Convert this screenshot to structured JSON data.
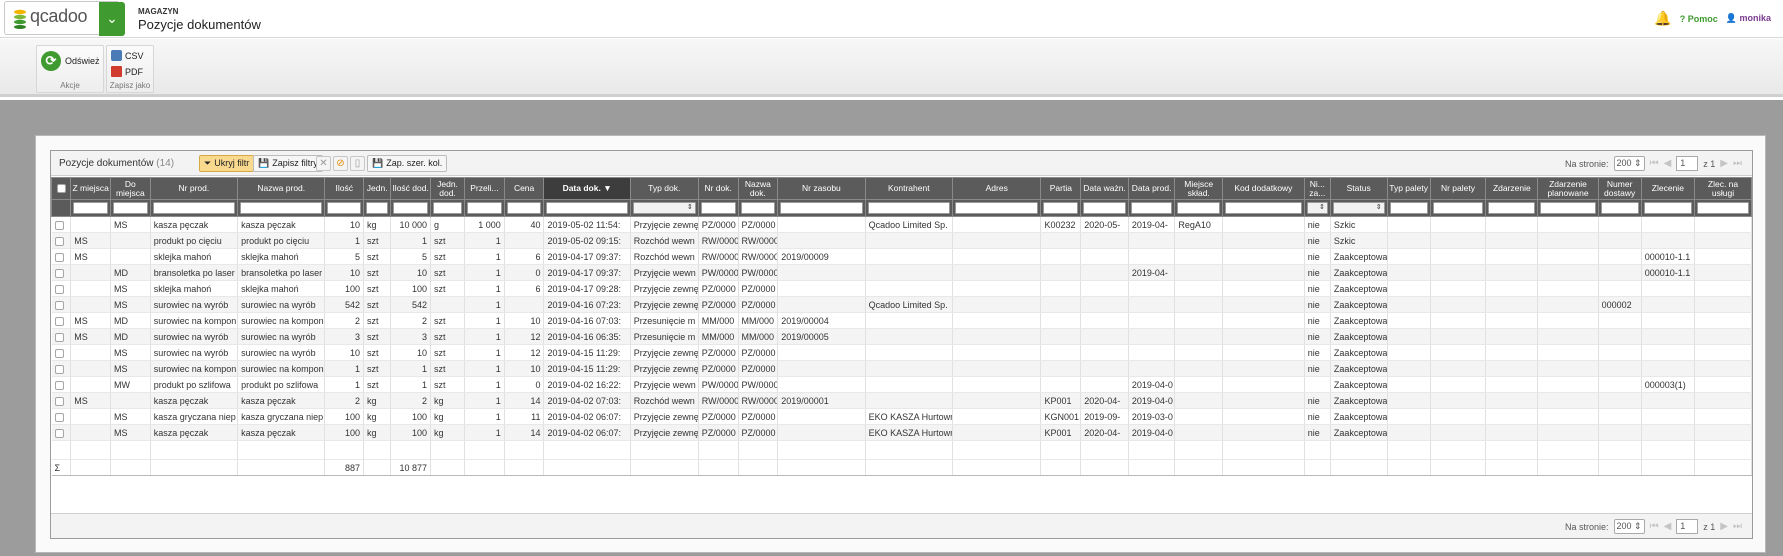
{
  "header": {
    "logo_text": "qcadoo",
    "section": "MAGAZYN",
    "title": "Pozycje dokumentów",
    "help": "Pomoc",
    "user": "monika"
  },
  "ribbon": {
    "refresh_label": "Odśwież",
    "actions_group": "Akcje",
    "csv_label": "CSV",
    "pdf_label": "PDF",
    "save_group": "Zapisz jako"
  },
  "grid": {
    "title": "Pozycje dokumentów",
    "count": "(14)",
    "hide_filter": "Ukryj filtr",
    "save_filters": "Zapisz filtry",
    "save_widths": "Zap. szer. kol.",
    "per_page_label": "Na stronie:",
    "per_page": "200",
    "page": "1",
    "of_pages": "z 1",
    "columns": [
      "",
      "Z miejsca",
      "Do miejsca",
      "Nr prod.",
      "Nazwa prod.",
      "Ilość",
      "Jedn.",
      "Ilość dod.",
      "Jedn. dod.",
      "Przeli...",
      "Cena",
      "Data dok.",
      "Typ dok.",
      "Nr dok.",
      "Nazwa dok.",
      "Nr zasobu",
      "Kontrahent",
      "Adres",
      "Partia",
      "Data ważn.",
      "Data prod.",
      "Miejsce skład.",
      "Kod dodatkowy",
      "Ni... za...",
      "Status",
      "Typ palety",
      "Nr palety",
      "Zdarzenie",
      "Zdarzenie planowane",
      "Numer dostawy",
      "Zlecenie",
      "Zlec. na usługi"
    ],
    "rows": [
      [
        "",
        "",
        "MS",
        "kasza pęczak",
        "kasza pęczak",
        "10",
        "kg",
        "10 000",
        "g",
        "1 000",
        "40",
        "2019-05-02 11:54:",
        "Przyjęcie zewnęt",
        "PZ/0000",
        "PZ/0000",
        "",
        "Qcadoo Limited Sp.",
        "",
        "K00232",
        "2020-05-",
        "2019-04-",
        "RegA10",
        "",
        "nie",
        "Szkic",
        "",
        "",
        "",
        "",
        "",
        "",
        ""
      ],
      [
        "",
        "MS",
        "",
        "produkt po cięciu",
        "produkt po cięciu",
        "1",
        "szt",
        "1",
        "szt",
        "1",
        "",
        "2019-05-02 09:15:",
        "Rozchód wewn",
        "RW/0000",
        "RW/0000",
        "",
        "",
        "",
        "",
        "",
        "",
        "",
        "",
        "nie",
        "Szkic",
        "",
        "",
        "",
        "",
        "",
        "",
        ""
      ],
      [
        "",
        "MS",
        "",
        "sklejka mahoń",
        "sklejka mahoń",
        "5",
        "szt",
        "5",
        "szt",
        "1",
        "6",
        "2019-04-17 09:37:",
        "Rozchód wewn",
        "RW/0000",
        "RW/0000",
        "2019/00009",
        "",
        "",
        "",
        "",
        "",
        "",
        "",
        "nie",
        "Zaakceptowa",
        "",
        "",
        "",
        "",
        "",
        "000010-1.1",
        ""
      ],
      [
        "",
        "",
        "MD",
        "bransoletka po laser",
        "bransoletka po laser",
        "10",
        "szt",
        "10",
        "szt",
        "1",
        "0",
        "2019-04-17 09:37:",
        "Przyjęcie wewn",
        "PW/0000",
        "PW/0000",
        "",
        "",
        "",
        "",
        "",
        "2019-04-",
        "",
        "",
        "nie",
        "Zaakceptowa",
        "",
        "",
        "",
        "",
        "",
        "000010-1.1",
        ""
      ],
      [
        "",
        "",
        "MS",
        "sklejka mahoń",
        "sklejka mahoń",
        "100",
        "szt",
        "100",
        "szt",
        "1",
        "6",
        "2019-04-17 09:28:",
        "Przyjęcie zewnęt",
        "PZ/0000",
        "PZ/0000",
        "",
        "",
        "",
        "",
        "",
        "",
        "",
        "",
        "nie",
        "Zaakceptowa",
        "",
        "",
        "",
        "",
        "",
        "",
        ""
      ],
      [
        "",
        "",
        "MS",
        "surowiec na wyrób",
        "surowiec na wyrób",
        "542",
        "szt",
        "542",
        "",
        "1",
        "",
        "2019-04-16 07:23:",
        "Przyjęcie zewnęt",
        "PZ/0000",
        "PZ/0000",
        "",
        "Qcadoo Limited Sp.",
        "",
        "",
        "",
        "",
        "",
        "",
        "nie",
        "Zaakceptowa",
        "",
        "",
        "",
        "",
        "000002",
        "",
        ""
      ],
      [
        "",
        "MS",
        "MD",
        "surowiec na kompon",
        "surowiec na kompon",
        "2",
        "szt",
        "2",
        "szt",
        "1",
        "10",
        "2019-04-16 07:03:",
        "Przesunięcie m",
        "MM/000",
        "MM/000",
        "2019/00004",
        "",
        "",
        "",
        "",
        "",
        "",
        "",
        "nie",
        "Zaakceptowa",
        "",
        "",
        "",
        "",
        "",
        "",
        ""
      ],
      [
        "",
        "MS",
        "MD",
        "surowiec na wyrób",
        "surowiec na wyrób",
        "3",
        "szt",
        "3",
        "szt",
        "1",
        "12",
        "2019-04-16 06:35:",
        "Przesunięcie m",
        "MM/000",
        "MM/000",
        "2019/00005",
        "",
        "",
        "",
        "",
        "",
        "",
        "",
        "nie",
        "Zaakceptowa",
        "",
        "",
        "",
        "",
        "",
        "",
        ""
      ],
      [
        "",
        "",
        "MS",
        "surowiec na wyrób",
        "surowiec na wyrób",
        "10",
        "szt",
        "10",
        "szt",
        "1",
        "12",
        "2019-04-15 11:29:",
        "Przyjęcie zewnęt",
        "PZ/0000",
        "PZ/0000",
        "",
        "",
        "",
        "",
        "",
        "",
        "",
        "",
        "nie",
        "Zaakceptowa",
        "",
        "",
        "",
        "",
        "",
        "",
        ""
      ],
      [
        "",
        "",
        "MS",
        "surowiec na kompon",
        "surowiec na kompon",
        "1",
        "szt",
        "1",
        "szt",
        "1",
        "10",
        "2019-04-15 11:29:",
        "Przyjęcie zewnęt",
        "PZ/0000",
        "PZ/0000",
        "",
        "",
        "",
        "",
        "",
        "",
        "",
        "",
        "nie",
        "Zaakceptowa",
        "",
        "",
        "",
        "",
        "",
        "",
        ""
      ],
      [
        "",
        "",
        "MW",
        "produkt po szlifowa",
        "produkt po szlifowa",
        "1",
        "szt",
        "1",
        "szt",
        "1",
        "0",
        "2019-04-02 16:22:",
        "Przyjęcie wewn",
        "PW/0000",
        "PW/0000",
        "",
        "",
        "",
        "",
        "",
        "2019-04-0",
        "",
        "",
        "",
        "Zaakceptowa",
        "",
        "",
        "",
        "",
        "",
        "000003(1)",
        ""
      ],
      [
        "",
        "MS",
        "",
        "kasza pęczak",
        "kasza pęczak",
        "2",
        "kg",
        "2",
        "kg",
        "1",
        "14",
        "2019-04-02 07:03:",
        "Rozchód wewn",
        "RW/0000",
        "RW/0000",
        "2019/00001",
        "",
        "",
        "KP001",
        "2020-04-",
        "2019-04-0",
        "",
        "",
        "nie",
        "Zaakceptowa",
        "",
        "",
        "",
        "",
        "",
        "",
        ""
      ],
      [
        "",
        "",
        "MS",
        "kasza gryczana niep",
        "kasza gryczana niep",
        "100",
        "kg",
        "100",
        "kg",
        "1",
        "11",
        "2019-04-02 06:07:",
        "Przyjęcie zewnęt",
        "PZ/0000",
        "PZ/0000",
        "",
        "EKO KASZA Hurtowr",
        "",
        "KGN001",
        "2019-09-",
        "2019-03-0",
        "",
        "",
        "nie",
        "Zaakceptowa",
        "",
        "",
        "",
        "",
        "",
        "",
        ""
      ],
      [
        "",
        "",
        "MS",
        "kasza pęczak",
        "kasza pęczak",
        "100",
        "kg",
        "100",
        "kg",
        "1",
        "14",
        "2019-04-02 06:07:",
        "Przyjęcie zewnęt",
        "PZ/0000",
        "PZ/0000",
        "",
        "EKO KASZA Hurtowr",
        "",
        "KP001",
        "2020-04-",
        "2019-04-0",
        "",
        "",
        "nie",
        "Zaakceptowa",
        "",
        "",
        "",
        "",
        "",
        "",
        ""
      ]
    ],
    "sum_symbol": "Σ",
    "sum_qty": "887",
    "sum_add_qty": "10 877"
  }
}
